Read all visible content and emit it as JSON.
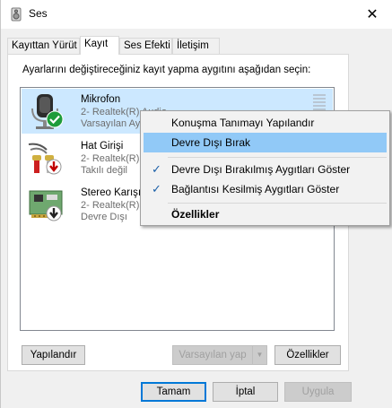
{
  "window": {
    "title": "Ses",
    "close_glyph": "✕"
  },
  "tabs": [
    {
      "label": "Kayıttan Yürüt"
    },
    {
      "label": "Kayıt"
    },
    {
      "label": "Ses Efekti"
    },
    {
      "label": "İletişim"
    }
  ],
  "panel": {
    "instruction": "Ayarlarını değiştireceğiniz kayıt yapma aygıtını aşağıdan seçin:"
  },
  "devices": [
    {
      "name": "Mikrofon",
      "line1": "2- Realtek(R) Audio",
      "line2": "Varsayılan Aygıt",
      "icon": "microphone-icon",
      "status_icon": "default-check-icon",
      "selected": true
    },
    {
      "name": "Hat Girişi",
      "line1": "2- Realtek(R) Audio",
      "line2": "Takılı değil",
      "icon": "line-in-icon",
      "status_icon": "not-plugged-icon",
      "selected": false
    },
    {
      "name": "Stereo Karışımı",
      "line1": "2- Realtek(R) Audio",
      "line2": "Devre Dışı",
      "icon": "stereo-mix-icon",
      "status_icon": "disabled-arrow-icon",
      "selected": false
    }
  ],
  "panel_buttons": {
    "configure": "Yapılandır",
    "set_default": "Varsayılan yap",
    "properties": "Özellikler"
  },
  "dialog_buttons": {
    "ok": "Tamam",
    "cancel": "İptal",
    "apply": "Uygula"
  },
  "context_menu": {
    "items": [
      {
        "label": "Konuşma Tanımayı Yapılandır",
        "checked": false,
        "highlighted": false,
        "bold": false
      },
      {
        "label": "Devre Dışı Bırak",
        "checked": false,
        "highlighted": true,
        "bold": false
      },
      {
        "label": "Devre Dışı Bırakılmış Aygıtları Göster",
        "checked": true,
        "highlighted": false,
        "bold": false
      },
      {
        "label": "Bağlantısı Kesilmiş Aygıtları Göster",
        "checked": true,
        "highlighted": false,
        "bold": false
      },
      {
        "label": "Özellikler",
        "checked": false,
        "highlighted": false,
        "bold": true
      }
    ],
    "check_glyph": "✓"
  },
  "colors": {
    "accent": "#0078d7",
    "selection": "#cce8ff",
    "menu_highlight": "#91c9f7"
  }
}
